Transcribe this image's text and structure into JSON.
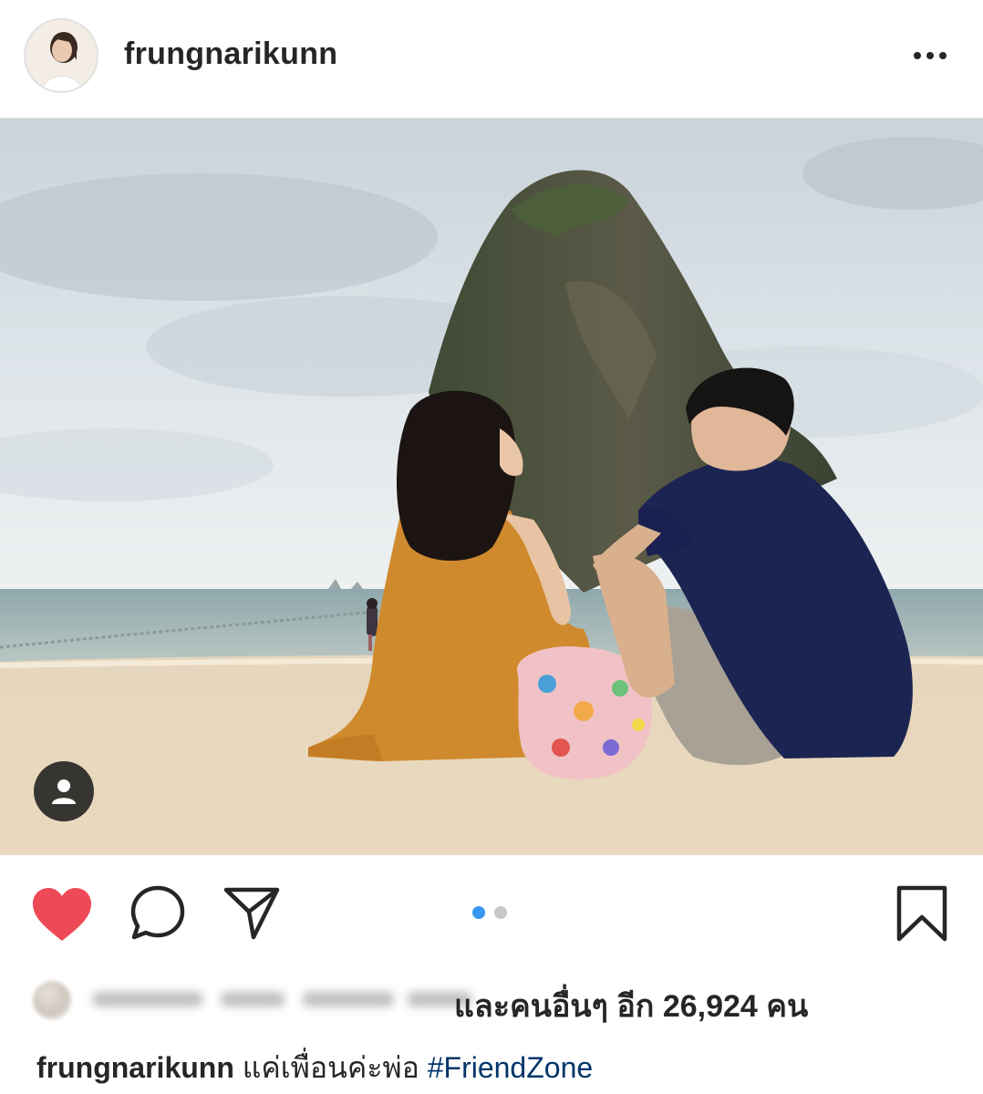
{
  "header": {
    "username": "frungnarikunn"
  },
  "icons": {
    "more": "more-horizontal-icon",
    "tag": "user-tag-icon",
    "like": "heart-filled-icon",
    "comment": "comment-bubble-icon",
    "share": "paper-plane-icon",
    "save": "bookmark-icon"
  },
  "colors": {
    "like_red": "#ed4956",
    "active_dot": "#3897f0",
    "inactive_dot": "#c7c7c7",
    "hashtag": "#003569"
  },
  "carousel": {
    "total": 2,
    "active_index": 0
  },
  "likes": {
    "text": "และคนอื่นๆ อีก 26,924 คน"
  },
  "caption": {
    "username": "frungnarikunn",
    "text": "แค่เพื่อนค่ะพ่อ",
    "hashtag": "#FriendZone"
  }
}
